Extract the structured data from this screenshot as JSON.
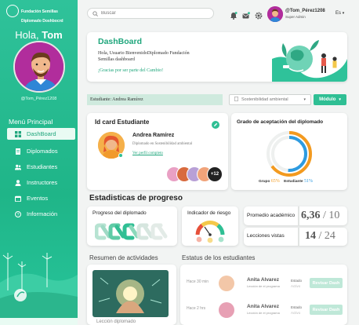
{
  "brand": {
    "line1": "Fundación Semillas",
    "line2": "Diplomado Doshbocrd"
  },
  "sidebar": {
    "greeting_prefix": "Hola,",
    "greeting_name": "Tom",
    "handle": "@Tom_Pérez1208",
    "menu_title": "Menú Principal",
    "items": [
      {
        "label": "DashBoard",
        "icon": "dashboard-grid-icon",
        "active": true
      },
      {
        "label": "Diplomados",
        "icon": "document-icon",
        "active": false
      },
      {
        "label": "Estudiantes",
        "icon": "students-icon",
        "active": false
      },
      {
        "label": "Instructores",
        "icon": "instructor-icon",
        "active": false
      },
      {
        "label": "Eventos",
        "icon": "calendar-icon",
        "active": false
      },
      {
        "label": "Información",
        "icon": "help-icon",
        "active": false
      }
    ]
  },
  "topbar": {
    "search_placeholder": "Buscar",
    "user_name": "@Tom_Pérez1208",
    "user_role": "Super Admin",
    "language": "Es"
  },
  "banner": {
    "title": "DashBoard",
    "text": "Hola, Usuario BienvenidoDiplomado Fundación\nSemillas dashboard",
    "message": "¡Gracias por ser parte del Cambio!"
  },
  "filter": {
    "student_label": "Estudiante: Andrea Ramírez",
    "select_value": "Sostenibilidad ambiental",
    "module_button": "Módulo"
  },
  "id_card": {
    "title": "Id card Estudiante",
    "name": "Andrea Ramírez",
    "description": "Diplomado en Sostenibilidad ambiental",
    "link": "Ver perfil completo",
    "extra_count": "+12"
  },
  "acceptance": {
    "title": "Grado de aceptación del diplomado",
    "group_label": "Grupo",
    "group_value": "65%",
    "student_label": "Estudiante",
    "student_value": "51%",
    "group_fraction": 0.65,
    "student_fraction": 0.51
  },
  "stats": {
    "title": "Estadisticas de progreso",
    "progress_label": "Progreso del diplomado",
    "risk_label": "Indicador de riesgo",
    "avg_label": "Promedio académico",
    "avg_value": "6,36",
    "avg_max": "10",
    "lessons_label": "Lecciones vistas",
    "lessons_value": "14",
    "lessons_max": "24"
  },
  "activity": {
    "title": "Resumen de actividades",
    "caption": "Lección diplomado"
  },
  "status": {
    "title": "Estatus de los estudiantes",
    "rows": [
      {
        "time": "Hace 30 min",
        "name": "Anita Alvarez",
        "desc": "Lección de el programa",
        "state_label": "Estado",
        "state": "Activo",
        "button": "Revisar Dash"
      },
      {
        "time": "Hace 2 hrs",
        "name": "Anita Alvarez",
        "desc": "Lección de el programa",
        "state_label": "Estado",
        "state": "Activo",
        "button": "Revisar Dash"
      }
    ]
  },
  "colors": {
    "primary": "#1fa67c",
    "accent": "#2fbf94",
    "orange": "#f39a1f",
    "blue": "#2e9be0"
  }
}
